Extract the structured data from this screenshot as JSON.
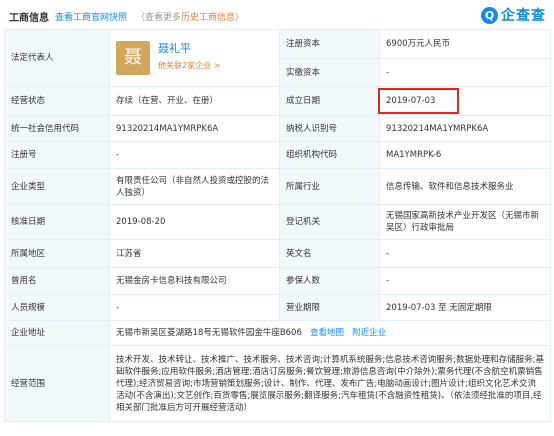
{
  "header": {
    "title": "工商信息",
    "official_link": "查看工商官网快照",
    "hint_prefix": "（查看更多",
    "hint_link": "历史工商信息",
    "hint_suffix": "）",
    "logo_mark": "Q",
    "logo_text": "企查查"
  },
  "legal_rep": {
    "label": "法定代表人",
    "avatar_char": "聂",
    "name": "聂礼平",
    "related": "他关联2家企业 >"
  },
  "rows": {
    "reg_capital": {
      "label": "注册资本",
      "value": "6900万元人民币"
    },
    "paid_capital": {
      "label": "实缴资本",
      "value": "-"
    },
    "status": {
      "label": "经营状态",
      "value": "存续（在营、开业、在册）"
    },
    "found_date": {
      "label": "成立日期",
      "value": "2019-07-03"
    },
    "credit_code": {
      "label": "统一社会信用代码",
      "value": "91320214MA1YMRPK6A"
    },
    "taxpayer_id": {
      "label": "纳税人识别号",
      "value": "91320214MA1YMRPK6A"
    },
    "reg_no": {
      "label": "注册号",
      "value": "-"
    },
    "org_code": {
      "label": "组织机构代码",
      "value": "MA1YMRPK-6"
    },
    "company_type": {
      "label": "企业类型",
      "value": "有限责任公司（非自然人投资或控股的法人独资）"
    },
    "industry": {
      "label": "所属行业",
      "value": "信息传输、软件和信息技术服务业"
    },
    "approve_date": {
      "label": "核准日期",
      "value": "2019-08-20"
    },
    "authority": {
      "label": "登记机关",
      "value": "无锡国家高新技术产业开发区（无锡市新吴区）行政审批局"
    },
    "region": {
      "label": "所属地区",
      "value": "江苏省"
    },
    "english_name": {
      "label": "英文名",
      "value": "-"
    },
    "former_name": {
      "label": "曾用名",
      "value": "无锡金房卡信息科技有限公司"
    },
    "insured": {
      "label": "参保人数",
      "value": "-"
    },
    "staff_size": {
      "label": "人员规模",
      "value": "-"
    },
    "business_term": {
      "label": "营业期限",
      "value": "2019-07-03 至 无固定期限"
    },
    "address": {
      "label": "企业地址",
      "value": "无锡市新吴区菱湖路18号无锡软件园金牛座B606",
      "map_link": "查看地图",
      "nearby_link": "附近企业"
    },
    "scope": {
      "label": "经营范围",
      "value": "技术开发、技术转让、技术推广、技术服务、技术咨询;计算机系统服务;信息技术咨询服务;数据处理和存储服务;基础软件服务;应用软件服务;酒店管理;酒店订房服务;餐饮管理;旅游信息咨询(中介除外);票务代理(不含航空机票销售代理);经济贸易咨询;市场营销策划服务;设计、制作、代理、发布广告;电脑动画设计;图片设计;组织文化艺术交流活动(不含演出);文艺创作;百货零售;展览展示服务;翻译服务;汽车租赁(不含融资性租赁)。（依法须经批准的项目,经相关部门批准后方可开展经营活动）"
    }
  }
}
